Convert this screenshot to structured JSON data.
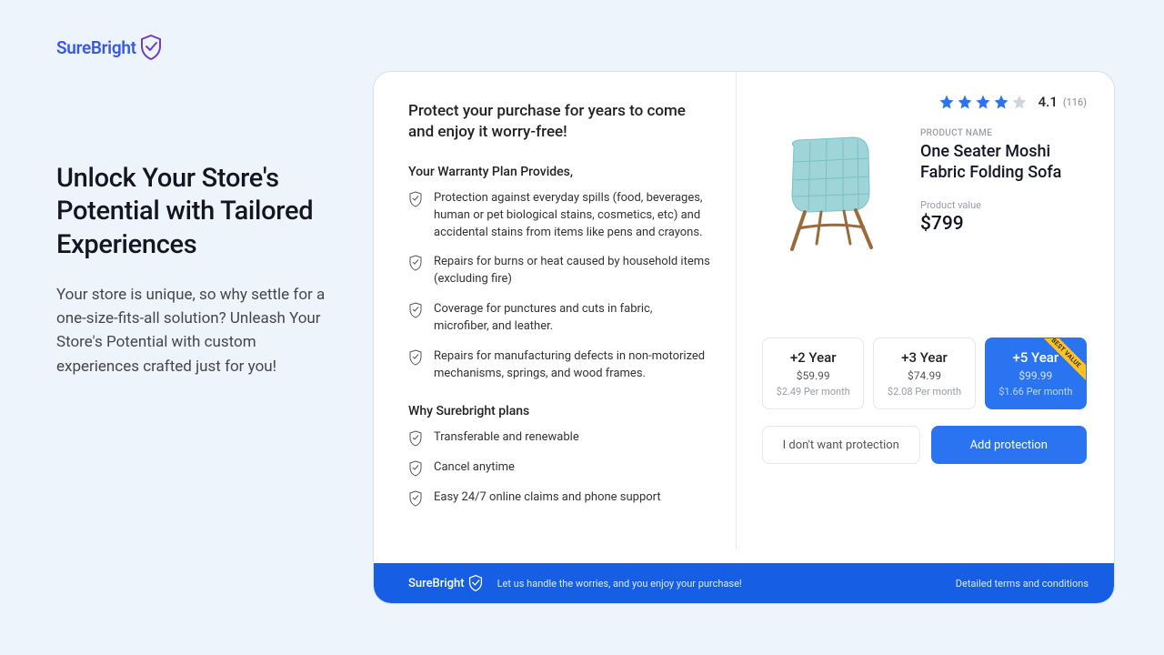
{
  "brand": "SureBright",
  "headline": "Unlock Your Store's Potential with Tailored Experiences",
  "subtext": "Your store is unique, so why settle for a one-size-fits-all solution? Unleash Your Store's Potential with custom experiences crafted just for you!",
  "widget": {
    "protect_title": "Protect your purchase for years to come and enjoy it worry-free!",
    "provides_heading": "Your Warranty Plan Provides,",
    "provides": [
      "Protection against everyday spills (food, beverages, human or pet biological stains, cosmetics, etc) and accidental stains from items like pens and crayons.",
      "Repairs for burns or heat caused by household items (excluding fire)",
      "Coverage for punctures and cuts in fabric, microfiber, and leather.",
      "Repairs for manufacturing defects in non-motorized mechanisms, springs, and wood frames."
    ],
    "why_heading": "Why Surebright plans",
    "why": [
      "Transferable and renewable",
      "Cancel anytime",
      "Easy 24/7 online claims and phone support"
    ],
    "product": {
      "label": "PRODUCT NAME",
      "name": "One Seater Moshi Fabric Folding Sofa",
      "value_label": "Product value",
      "price": "$799",
      "rating": "4.1",
      "rating_count": "(116)"
    },
    "plans": [
      {
        "title": "+2 Year",
        "price": "$59.99",
        "month": "$2.49 Per month",
        "selected": false
      },
      {
        "title": "+3 Year",
        "price": "$74.99",
        "month": "$2.08 Per month",
        "selected": false
      },
      {
        "title": "+5 Year",
        "price": "$99.99",
        "month": "$1.66 Per month",
        "selected": true,
        "badge": "BEST VALUE"
      }
    ],
    "cta": {
      "decline": "I don't want protection",
      "accept": "Add protection"
    },
    "footer": {
      "tagline": "Let us handle the worries, and you enjoy your purchase!",
      "terms": "Detailed terms and conditions"
    }
  },
  "colors": {
    "accent": "#2a74f1",
    "brand_purple": "#6c3fc5"
  }
}
